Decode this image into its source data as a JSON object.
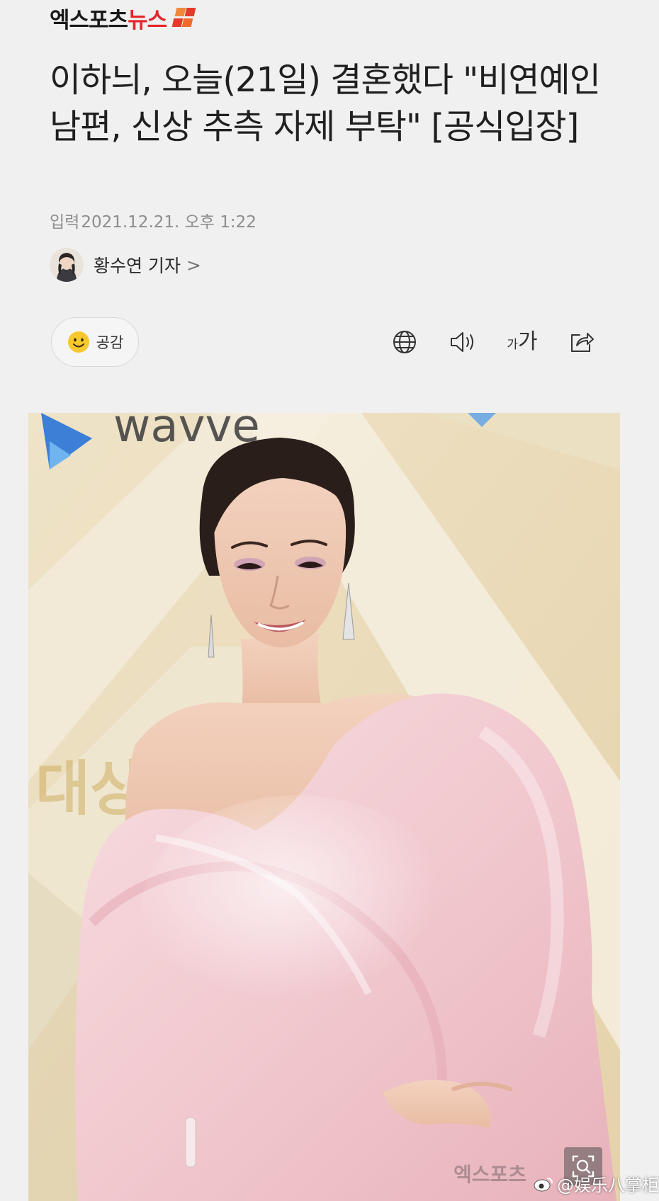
{
  "brand": {
    "logo_text_main": "엑스포츠",
    "logo_text_accent": "뉴스"
  },
  "article": {
    "headline": "이하늬, 오늘(21일) 결혼했다 \"비연예인 남편, 신상 추측 자제 부탁\" [공식입장]",
    "timestamp_label": "입력",
    "timestamp_value": "2021.12.21. 오후 1:22",
    "reporter_name": "황수연 기자",
    "reporter_chevron": ">"
  },
  "toolbar": {
    "like_label": "공감",
    "font_size_small": "가",
    "font_size_large": "가",
    "icons": [
      "globe-icon",
      "speaker-icon",
      "font-size-icon",
      "share-icon"
    ]
  },
  "photo": {
    "wall_text": "wavve",
    "wall_text_korean": "대상",
    "photo_watermark": "엑스포츠",
    "zoom_icon": "zoom-icon"
  },
  "watermark": {
    "text": "@娱乐八掌柜",
    "icon": "weibo-icon"
  },
  "colors": {
    "brand_red": "#e3262c",
    "headline": "#202020",
    "meta_gray": "#8d8d8d",
    "background": "#f0f0f0",
    "dress_pink": "#f1c9cf"
  }
}
